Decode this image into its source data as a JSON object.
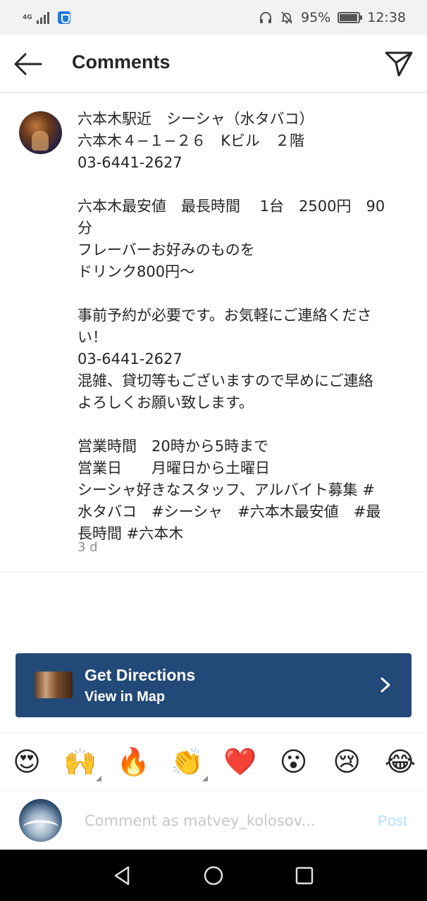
{
  "status_bar": {
    "network": "4G",
    "battery_percent": "95%",
    "battery_level": 0.95,
    "time": "12:38",
    "icons": [
      "signal-icon",
      "vpn-shield-icon",
      "headphones-icon",
      "mute-icon",
      "battery-icon"
    ]
  },
  "header": {
    "title": "Comments",
    "back_icon": "back-arrow-icon",
    "share_icon": "send-icon"
  },
  "comment": {
    "text": "六本木駅近　シーシャ（水タバコ）\n六本木４−１−２６　Kビル　２階\n03-6441-2627\n\n六本木最安値　最長時間　 1台　2500円　90分\nフレーバーお好みのものを\nドリンク800円〜\n\n事前予約が必要です。お気軽にご連絡ください！\n03-6441-2627\n混雑、貸切等もございますので早めにご連絡よろしくお願い致します。\n\n営業時間　20時から5時まで\n営業日　　月曜日から土曜日\nシーシャ好きなスタッフ、アルバイト募集 #水タバコ　#シーシャ　#六本木最安値　#最長時間 #六本木",
    "time_ago": "3 d"
  },
  "directions": {
    "title": "Get Directions",
    "subtitle": "View in Map",
    "background_color": "#224977"
  },
  "emoji_reactions": [
    "😍",
    "🙌",
    "🔥",
    "👏",
    "❤️",
    "😮",
    "😢",
    "😂"
  ],
  "comment_input": {
    "placeholder": "Comment as matvey_kolosov...",
    "post_label": "Post",
    "post_color": "#b2dffc"
  },
  "nav_bar": {
    "icons": [
      "nav-back-icon",
      "nav-home-icon",
      "nav-recents-icon"
    ]
  }
}
